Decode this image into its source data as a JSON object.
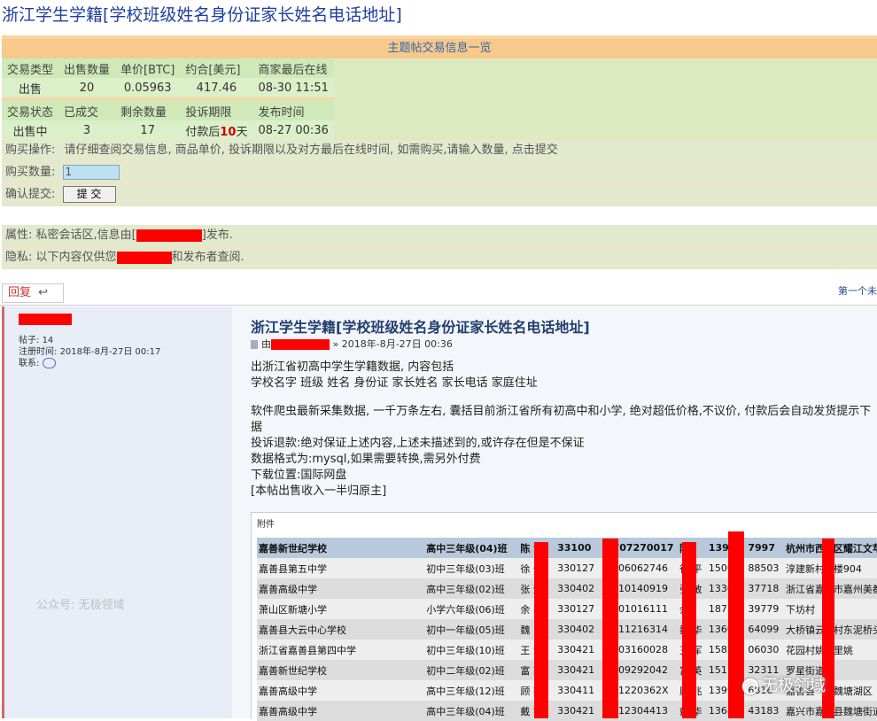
{
  "page_title": "浙江学生学籍[学校班级姓名身份证家长姓名电话地址]",
  "thread_info": {
    "header": "主题帖交易信息一览",
    "row1_keys": [
      "交易类型",
      "出售数量",
      "单价[BTC]",
      "约合[美元]",
      "商家最后在线"
    ],
    "row1_vals": [
      "出售",
      "20",
      "0.05963",
      "417.46",
      "08-30 11:51"
    ],
    "row2_keys": [
      "交易状态",
      "已成交",
      "剩余数量",
      "投诉期限",
      "发布时间"
    ],
    "row2_vals": [
      "出售中",
      "3",
      "17",
      "付款后",
      "08-27 00:36"
    ],
    "complaint_days": "10",
    "complaint_unit": "天"
  },
  "buy": {
    "op_label": "购买操作:",
    "op_text": "请仔细查阅交易信息, 商品单价, 投诉期限以及对方最后在线时间, 如需购买,请输入数量, 点击提交",
    "qty_label": "购买数量:",
    "qty_value": "1",
    "confirm_label": "确认提交:",
    "submit_label": "提 交"
  },
  "attributes": {
    "attr_text_before": "属性: 私密会话区,信息由[",
    "attr_text_after": "]发布.",
    "privacy_text_before": "隐私: 以下内容仅供您",
    "privacy_text_after": "和发布者查阅."
  },
  "reply_label": "回复",
  "first_post_label": "第一个未",
  "sidebar": {
    "posts_label": "帖子:",
    "posts_value": "14",
    "reg_label": "注册时间:",
    "reg_value": "2018年-8月-27日 00:17",
    "contact_label": "联系:",
    "watermark": "公众号: 无极领域"
  },
  "post": {
    "title": "浙江学生学籍[学校班级姓名身份证家长姓名电话地址]",
    "meta_prefix": "由",
    "meta_suffix": "» 2018年-8月-27日 00:36",
    "body": [
      "出浙江省初高中学生学籍数据, 内容包括",
      "学校名字 班级 姓名 身份证 家长姓名 家长电话 家庭住址",
      "",
      "软件爬虫最新采集数据, 一千万条左右, 囊括目前浙江省所有初高中和小学, 绝对超低价格,不议价, 付款后会自动发货提示下",
      "据",
      "投诉退款:绝对保证上述内容,上述未描述到的,或许存在但是不保证",
      "数据格式为:mysql,如果需要转换,需另外付费",
      "下载位置:国际网盘",
      "[本帖出售收入一半归原主]"
    ],
    "attachment_label": "附件"
  },
  "attachment_rows": [
    [
      "嘉善新世纪学校",
      "高中三年级(04)班",
      "陈  俞",
      "33100",
      "9707270017",
      "陈",
      "1392",
      "7997",
      "杭州市西",
      "区耀江文苹"
    ],
    [
      "嘉善县第五中学",
      "初中三年级(03)班",
      "徐  何",
      "330127",
      "0006062746",
      "徐  平",
      "1506",
      "88503",
      "淳建新村",
      "楼904"
    ],
    [
      "嘉善高级中学",
      "高中三年级(02)班",
      "张  懿",
      "330402",
      "0610140919",
      "张  敏",
      "1330",
      "37718",
      "浙江省嘉",
      "市嘉州美都"
    ],
    [
      "萧山区新塘小学",
      "小学六年级(06)班",
      "余  鑫",
      "330127",
      "0601016111",
      "余",
      "1875",
      "39779",
      "下坊村",
      ""
    ],
    [
      "嘉善县大云中心学校",
      "初中一年级(05)班",
      "魏",
      "330402",
      "0411216314",
      "魏  华",
      "1360",
      "64099",
      "大桥镇云",
      "村东泥桥头"
    ],
    [
      "浙江省嘉善县第四中学",
      "初中三年级(10)班",
      "王  清",
      "330421",
      "0203160028",
      "王  军",
      "1582",
      "06030",
      "花园村姚",
      "里姚"
    ],
    [
      "嘉善新世纪学校",
      "初中二年级(02)班",
      "富  奕",
      "330421",
      "0409292042",
      "富  英",
      "151",
      "32311",
      "罗星街道",
      ""
    ],
    [
      "嘉善高级中学",
      "高中三年级(12)班",
      "顾  燕",
      "330411",
      "081220362X",
      "顾  兆",
      "1399",
      "6816",
      "嘉善县",
      "魏塘湖区"
    ],
    [
      "嘉善高级中学",
      "高中三年级(04)班",
      "戴  宇",
      "330421",
      "0512304413",
      "戴  华",
      "1368",
      "43183",
      "嘉兴市嘉",
      "县魏塘街道"
    ]
  ],
  "watermark_right": "无极领域",
  "colors": {
    "redaction": "#ff0000",
    "title_blue": "#1f3f9f",
    "panel_green": "#dde9bf",
    "panel_orange": "#f7c98b"
  }
}
